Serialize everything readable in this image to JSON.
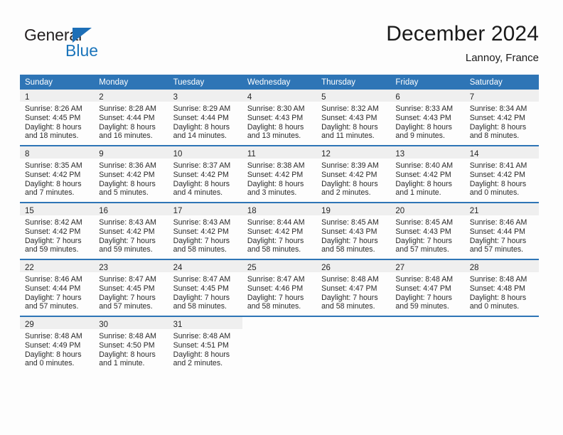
{
  "brand": {
    "name_part1": "General",
    "name_part2": "Blue",
    "accent_color": "#1b75bb",
    "triangle_icon": "triangle-right-icon"
  },
  "header": {
    "title": "December 2024",
    "location": "Lannoy, France"
  },
  "colors": {
    "header_band": "#2e75b6",
    "daynum_band": "#efefef",
    "text": "#2a2a2a"
  },
  "weekday_headers": [
    "Sunday",
    "Monday",
    "Tuesday",
    "Wednesday",
    "Thursday",
    "Friday",
    "Saturday"
  ],
  "weeks": [
    [
      {
        "day": "1",
        "sunrise": "Sunrise: 8:26 AM",
        "sunset": "Sunset: 4:45 PM",
        "daylight1": "Daylight: 8 hours",
        "daylight2": "and 18 minutes."
      },
      {
        "day": "2",
        "sunrise": "Sunrise: 8:28 AM",
        "sunset": "Sunset: 4:44 PM",
        "daylight1": "Daylight: 8 hours",
        "daylight2": "and 16 minutes."
      },
      {
        "day": "3",
        "sunrise": "Sunrise: 8:29 AM",
        "sunset": "Sunset: 4:44 PM",
        "daylight1": "Daylight: 8 hours",
        "daylight2": "and 14 minutes."
      },
      {
        "day": "4",
        "sunrise": "Sunrise: 8:30 AM",
        "sunset": "Sunset: 4:43 PM",
        "daylight1": "Daylight: 8 hours",
        "daylight2": "and 13 minutes."
      },
      {
        "day": "5",
        "sunrise": "Sunrise: 8:32 AM",
        "sunset": "Sunset: 4:43 PM",
        "daylight1": "Daylight: 8 hours",
        "daylight2": "and 11 minutes."
      },
      {
        "day": "6",
        "sunrise": "Sunrise: 8:33 AM",
        "sunset": "Sunset: 4:43 PM",
        "daylight1": "Daylight: 8 hours",
        "daylight2": "and 9 minutes."
      },
      {
        "day": "7",
        "sunrise": "Sunrise: 8:34 AM",
        "sunset": "Sunset: 4:42 PM",
        "daylight1": "Daylight: 8 hours",
        "daylight2": "and 8 minutes."
      }
    ],
    [
      {
        "day": "8",
        "sunrise": "Sunrise: 8:35 AM",
        "sunset": "Sunset: 4:42 PM",
        "daylight1": "Daylight: 8 hours",
        "daylight2": "and 7 minutes."
      },
      {
        "day": "9",
        "sunrise": "Sunrise: 8:36 AM",
        "sunset": "Sunset: 4:42 PM",
        "daylight1": "Daylight: 8 hours",
        "daylight2": "and 5 minutes."
      },
      {
        "day": "10",
        "sunrise": "Sunrise: 8:37 AM",
        "sunset": "Sunset: 4:42 PM",
        "daylight1": "Daylight: 8 hours",
        "daylight2": "and 4 minutes."
      },
      {
        "day": "11",
        "sunrise": "Sunrise: 8:38 AM",
        "sunset": "Sunset: 4:42 PM",
        "daylight1": "Daylight: 8 hours",
        "daylight2": "and 3 minutes."
      },
      {
        "day": "12",
        "sunrise": "Sunrise: 8:39 AM",
        "sunset": "Sunset: 4:42 PM",
        "daylight1": "Daylight: 8 hours",
        "daylight2": "and 2 minutes."
      },
      {
        "day": "13",
        "sunrise": "Sunrise: 8:40 AM",
        "sunset": "Sunset: 4:42 PM",
        "daylight1": "Daylight: 8 hours",
        "daylight2": "and 1 minute."
      },
      {
        "day": "14",
        "sunrise": "Sunrise: 8:41 AM",
        "sunset": "Sunset: 4:42 PM",
        "daylight1": "Daylight: 8 hours",
        "daylight2": "and 0 minutes."
      }
    ],
    [
      {
        "day": "15",
        "sunrise": "Sunrise: 8:42 AM",
        "sunset": "Sunset: 4:42 PM",
        "daylight1": "Daylight: 7 hours",
        "daylight2": "and 59 minutes."
      },
      {
        "day": "16",
        "sunrise": "Sunrise: 8:43 AM",
        "sunset": "Sunset: 4:42 PM",
        "daylight1": "Daylight: 7 hours",
        "daylight2": "and 59 minutes."
      },
      {
        "day": "17",
        "sunrise": "Sunrise: 8:43 AM",
        "sunset": "Sunset: 4:42 PM",
        "daylight1": "Daylight: 7 hours",
        "daylight2": "and 58 minutes."
      },
      {
        "day": "18",
        "sunrise": "Sunrise: 8:44 AM",
        "sunset": "Sunset: 4:42 PM",
        "daylight1": "Daylight: 7 hours",
        "daylight2": "and 58 minutes."
      },
      {
        "day": "19",
        "sunrise": "Sunrise: 8:45 AM",
        "sunset": "Sunset: 4:43 PM",
        "daylight1": "Daylight: 7 hours",
        "daylight2": "and 58 minutes."
      },
      {
        "day": "20",
        "sunrise": "Sunrise: 8:45 AM",
        "sunset": "Sunset: 4:43 PM",
        "daylight1": "Daylight: 7 hours",
        "daylight2": "and 57 minutes."
      },
      {
        "day": "21",
        "sunrise": "Sunrise: 8:46 AM",
        "sunset": "Sunset: 4:44 PM",
        "daylight1": "Daylight: 7 hours",
        "daylight2": "and 57 minutes."
      }
    ],
    [
      {
        "day": "22",
        "sunrise": "Sunrise: 8:46 AM",
        "sunset": "Sunset: 4:44 PM",
        "daylight1": "Daylight: 7 hours",
        "daylight2": "and 57 minutes."
      },
      {
        "day": "23",
        "sunrise": "Sunrise: 8:47 AM",
        "sunset": "Sunset: 4:45 PM",
        "daylight1": "Daylight: 7 hours",
        "daylight2": "and 57 minutes."
      },
      {
        "day": "24",
        "sunrise": "Sunrise: 8:47 AM",
        "sunset": "Sunset: 4:45 PM",
        "daylight1": "Daylight: 7 hours",
        "daylight2": "and 58 minutes."
      },
      {
        "day": "25",
        "sunrise": "Sunrise: 8:47 AM",
        "sunset": "Sunset: 4:46 PM",
        "daylight1": "Daylight: 7 hours",
        "daylight2": "and 58 minutes."
      },
      {
        "day": "26",
        "sunrise": "Sunrise: 8:48 AM",
        "sunset": "Sunset: 4:47 PM",
        "daylight1": "Daylight: 7 hours",
        "daylight2": "and 58 minutes."
      },
      {
        "day": "27",
        "sunrise": "Sunrise: 8:48 AM",
        "sunset": "Sunset: 4:47 PM",
        "daylight1": "Daylight: 7 hours",
        "daylight2": "and 59 minutes."
      },
      {
        "day": "28",
        "sunrise": "Sunrise: 8:48 AM",
        "sunset": "Sunset: 4:48 PM",
        "daylight1": "Daylight: 8 hours",
        "daylight2": "and 0 minutes."
      }
    ],
    [
      {
        "day": "29",
        "sunrise": "Sunrise: 8:48 AM",
        "sunset": "Sunset: 4:49 PM",
        "daylight1": "Daylight: 8 hours",
        "daylight2": "and 0 minutes."
      },
      {
        "day": "30",
        "sunrise": "Sunrise: 8:48 AM",
        "sunset": "Sunset: 4:50 PM",
        "daylight1": "Daylight: 8 hours",
        "daylight2": "and 1 minute."
      },
      {
        "day": "31",
        "sunrise": "Sunrise: 8:48 AM",
        "sunset": "Sunset: 4:51 PM",
        "daylight1": "Daylight: 8 hours",
        "daylight2": "and 2 minutes."
      },
      {
        "day": "",
        "sunrise": "",
        "sunset": "",
        "daylight1": "",
        "daylight2": ""
      },
      {
        "day": "",
        "sunrise": "",
        "sunset": "",
        "daylight1": "",
        "daylight2": ""
      },
      {
        "day": "",
        "sunrise": "",
        "sunset": "",
        "daylight1": "",
        "daylight2": ""
      },
      {
        "day": "",
        "sunrise": "",
        "sunset": "",
        "daylight1": "",
        "daylight2": ""
      }
    ]
  ]
}
